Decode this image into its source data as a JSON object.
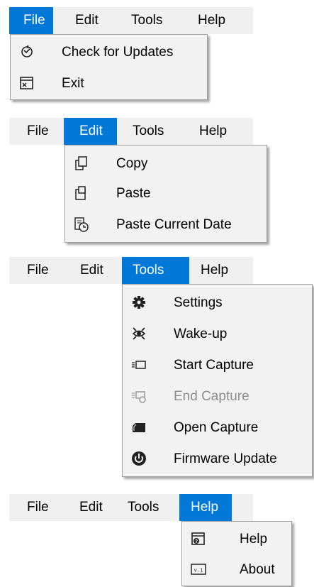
{
  "menus": [
    {
      "label": "File"
    },
    {
      "label": "Edit"
    },
    {
      "label": "Tools"
    },
    {
      "label": "Help"
    }
  ],
  "file_menu": {
    "items": [
      {
        "label": "Check for Updates",
        "icon": "update-check-icon"
      },
      {
        "label": "Exit",
        "icon": "exit-icon"
      }
    ]
  },
  "edit_menu": {
    "items": [
      {
        "label": "Copy",
        "icon": "copy-icon"
      },
      {
        "label": "Paste",
        "icon": "paste-icon"
      },
      {
        "label": "Paste Current Date",
        "icon": "paste-date-icon"
      }
    ]
  },
  "tools_menu": {
    "items": [
      {
        "label": "Settings",
        "icon": "gear-icon",
        "enabled": true
      },
      {
        "label": "Wake-up",
        "icon": "wake-up-icon",
        "enabled": true
      },
      {
        "label": "Start Capture",
        "icon": "start-capture-icon",
        "enabled": true
      },
      {
        "label": "End Capture",
        "icon": "end-capture-icon",
        "enabled": false
      },
      {
        "label": "Open Capture",
        "icon": "open-capture-icon",
        "enabled": true
      },
      {
        "label": "Firmware Update",
        "icon": "firmware-update-icon",
        "enabled": true
      }
    ]
  },
  "help_menu": {
    "items": [
      {
        "label": "Help",
        "icon": "help-icon"
      },
      {
        "label": "About",
        "icon": "about-icon"
      }
    ]
  },
  "colors": {
    "menubar_bg": "#f0f0f0",
    "active_bg": "#0078d7",
    "dropdown_bg": "#f2f2f2",
    "disabled_text": "#8d8d8d"
  }
}
